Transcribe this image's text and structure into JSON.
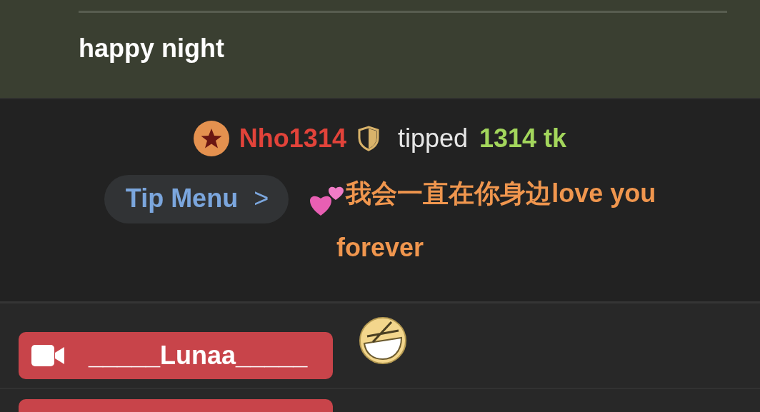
{
  "previous_message": {
    "text": "happy night"
  },
  "tip_event": {
    "user": "Nho1314",
    "action": "tipped",
    "amount": "1314 tk",
    "menu_button": "Tip Menu",
    "chevron": ">",
    "message": "我会一直在你身边love you forever"
  },
  "chat": [
    {
      "user": "_____Lunaa_____",
      "kind": "sticker"
    },
    {
      "kind": "cut"
    }
  ]
}
